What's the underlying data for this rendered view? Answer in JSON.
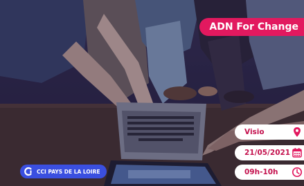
{
  "event": {
    "title": "ADN For Change",
    "mode": "Visio",
    "date": "21/05/2021",
    "time": "09h-10h"
  },
  "organizer": {
    "logo_text": "CCI PAYS DE LA LOIRE"
  },
  "icons": {
    "mode": "location-pin-icon",
    "date": "calendar-icon",
    "time": "clock-icon"
  },
  "colors": {
    "accent": "#e2195f",
    "logo_bg": "#3a4fe0",
    "overlay": "#221a46"
  }
}
